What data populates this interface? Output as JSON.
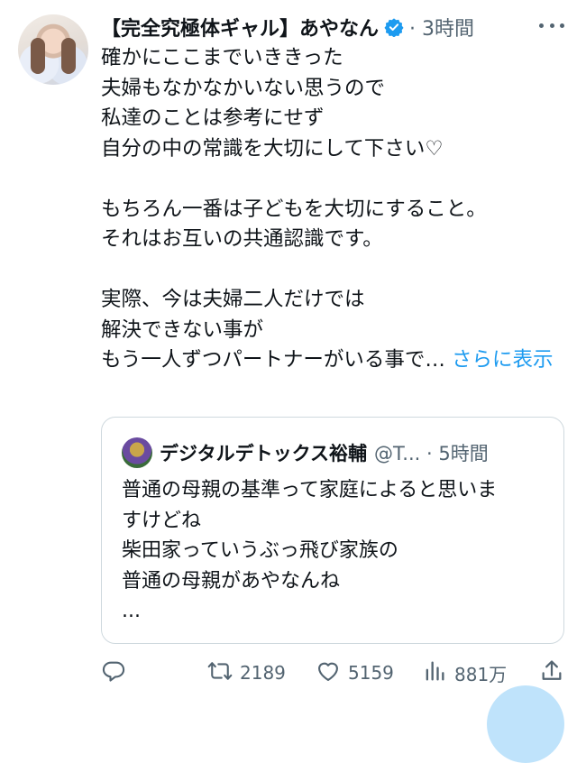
{
  "tweet": {
    "display_name": "【完全究極体ギャル】あやなん",
    "meta": "· 3時間",
    "body": "確かにここまでいききった\n夫婦もなかなかいない思うので\n私達のことは参考にせず\n自分の中の常識を大切にして下さい♡\n\nもちろん一番は子どもを大切にすること。\nそれはお互いの共通認識です。\n\n実際、今は夫婦二人だけでは\n解決できない事が\nもう一人ずつパートナーがいる事で… ",
    "show_more": "さらに表示"
  },
  "quote": {
    "display_name": "デジタルデトックス裕輔",
    "meta": "@T... · 5時間",
    "body": "普通の母親の基準って家庭によると思いま\nすけどね\n柴田家っていうぶっ飛び家族の\n普通の母親があやなんね\n..."
  },
  "actions": {
    "retweets": "2189",
    "likes": "5159",
    "views": "881万"
  },
  "icons": {
    "verified": "verified-badge-icon",
    "more": "more-icon",
    "reply": "reply-icon",
    "retweet": "retweet-icon",
    "like": "heart-icon",
    "views": "views-icon",
    "share": "share-icon"
  },
  "colors": {
    "accent": "#1d9bf0",
    "text": "#0f1419",
    "secondary": "#536471",
    "border": "#cfd9de"
  }
}
